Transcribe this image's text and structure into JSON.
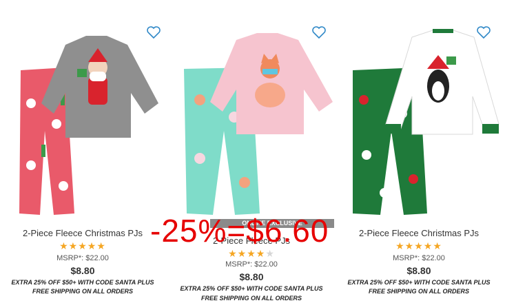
{
  "products": [
    {
      "title": "2-Piece Fleece Christmas PJs",
      "rating": 5,
      "msrp": "MSRP*: $22.00",
      "price": "$8.80",
      "promo": "EXTRA 25% OFF $50+ WITH CODE SANTA PLUS",
      "shipping": "FREE SHIPPING ON ALL ORDERS",
      "icons": [
        "heart-icon"
      ],
      "colors": {
        "pants": "#e95a6a",
        "top": "#8f8f8f"
      }
    },
    {
      "badge": "ONLINE EXCLUSIVE",
      "title": "2-Piece Fleece PJs",
      "rating": 4,
      "msrp": "MSRP*: $22.00",
      "price": "$8.80",
      "promo": "EXTRA 25% OFF $50+ WITH CODE SANTA PLUS",
      "shipping": "FREE SHIPPING ON ALL ORDERS",
      "icons": [
        "heart-icon"
      ],
      "colors": {
        "pants": "#7fdcc9",
        "top": "#f6c4cf"
      }
    },
    {
      "title": "2-Piece Fleece Christmas PJs",
      "rating": 5,
      "msrp": "MSRP*: $22.00",
      "price": "$8.80",
      "promo": "EXTRA 25% OFF $50+ WITH CODE SANTA PLUS",
      "shipping": "FREE SHIPPING ON ALL ORDERS",
      "icons": [
        "heart-icon"
      ],
      "colors": {
        "pants": "#1f7a3a",
        "top": "#ffffff"
      }
    }
  ],
  "annotation": {
    "text": "-25%=$6.60",
    "color": "#e60000"
  },
  "colors": {
    "heart": "#2f88c7",
    "stars": "#f5a623",
    "badge_bg": "#8a8a8a"
  }
}
